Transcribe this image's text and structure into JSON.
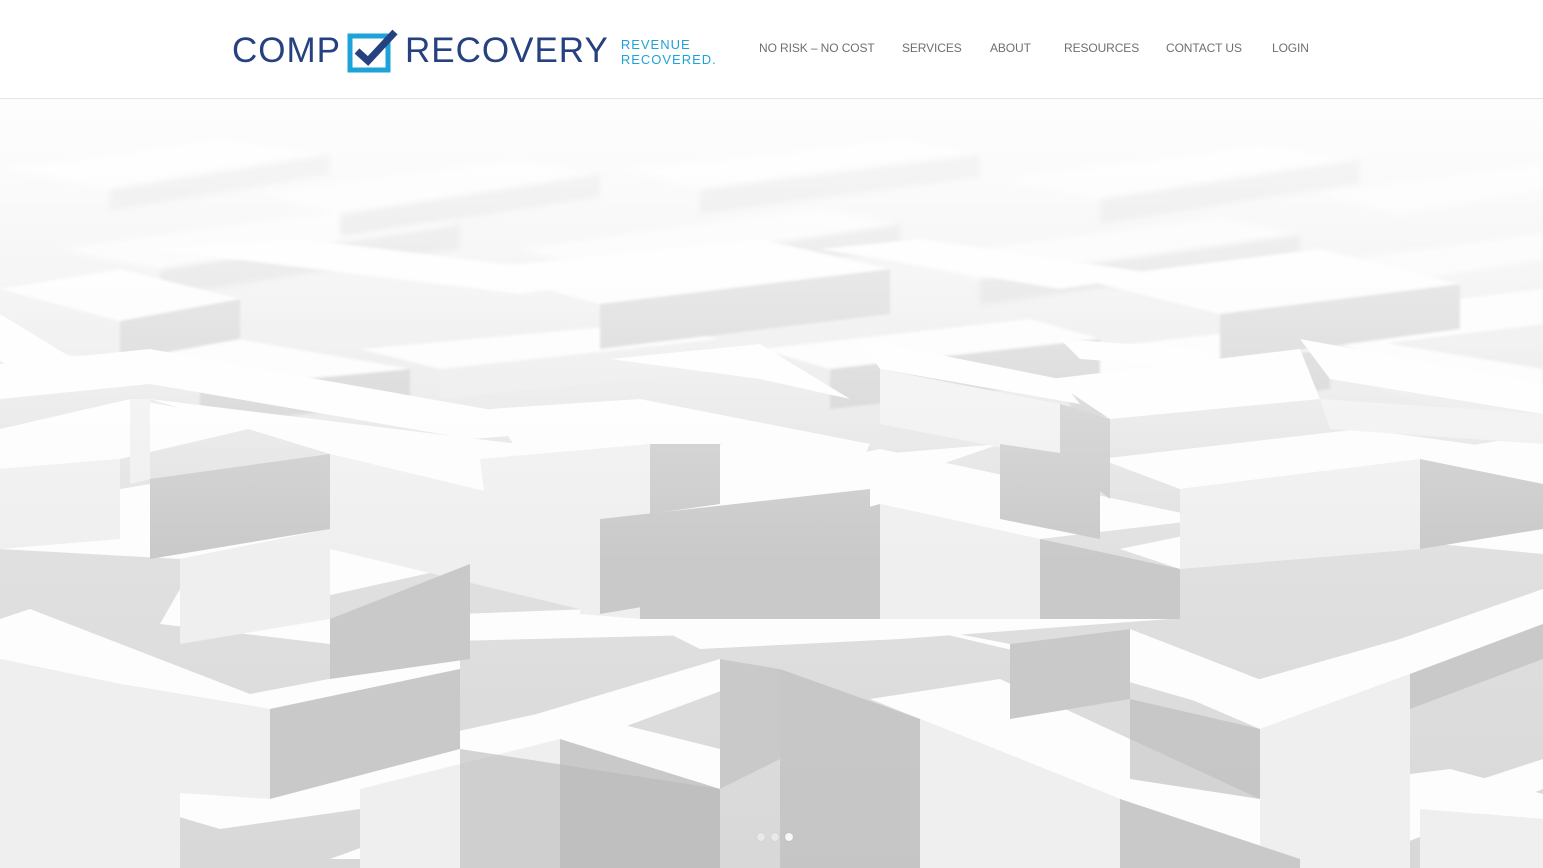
{
  "brand": {
    "word_left": "COMP",
    "word_right": "RECOVERY",
    "tagline_line1": "REVENUE",
    "tagline_line2": "RECOVERED.",
    "primary_color": "#26417f",
    "accent_color": "#1ea3d8",
    "logo_icon": "checkbox-check-icon"
  },
  "nav": {
    "items": [
      {
        "label": "NO RISK – NO COST"
      },
      {
        "label": "SERVICES"
      },
      {
        "label": "ABOUT"
      },
      {
        "label": "RESOURCES"
      },
      {
        "label": "CONTACT US"
      },
      {
        "label": "LOGIN"
      }
    ],
    "text_color": "#6f6f6f"
  },
  "hero": {
    "image": "white-3d-maze",
    "slider": {
      "slide_count": 3,
      "active_slide": 3
    }
  }
}
